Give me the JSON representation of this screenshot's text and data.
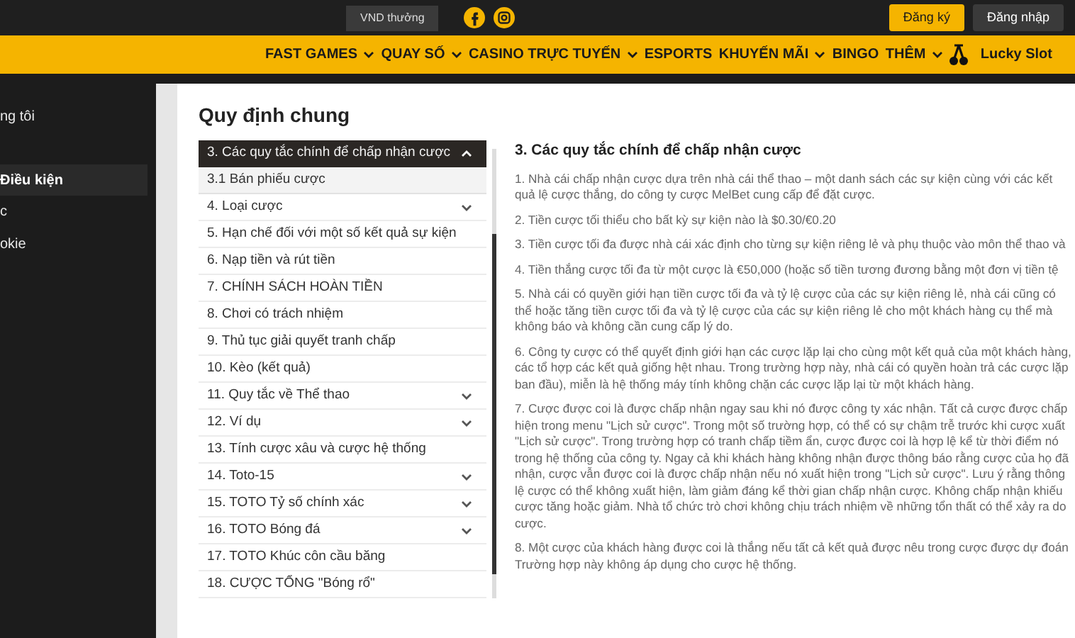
{
  "top_bar": {
    "bonus_text": "VND thưởng",
    "register": "Đăng ký",
    "login": "Đăng nhập"
  },
  "nav": [
    {
      "label": "FAST GAMES",
      "dropdown": true
    },
    {
      "label": "QUAY SỐ",
      "dropdown": true
    },
    {
      "label": "CASINO TRỰC TUYẾN",
      "dropdown": true
    },
    {
      "label": "ESPORTS",
      "dropdown": false
    },
    {
      "label": "KHUYẾN MÃI",
      "dropdown": true
    },
    {
      "label": "BINGO",
      "dropdown": false
    },
    {
      "label": "THÊM",
      "dropdown": true
    },
    {
      "label": "Lucky Slot",
      "kind": "slot"
    }
  ],
  "sidebar": {
    "items": [
      {
        "label": "ng tôi",
        "selected": false
      },
      {
        "label": "Điều kiện",
        "selected": true
      },
      {
        "label": "c",
        "selected": false
      },
      {
        "label": "okie",
        "selected": false
      }
    ]
  },
  "page_title": "Quy định chung",
  "accordion": [
    {
      "label": "3. Các quy tắc chính để chấp nhận cược",
      "kind": "header",
      "expanded": true
    },
    {
      "label": "3.1 Bán phiếu cược",
      "kind": "sub"
    },
    {
      "label": "4. Loại cược",
      "kind": "item",
      "expandable": true
    },
    {
      "label": "5. Hạn chế đối với một số kết quả sự kiện",
      "kind": "item",
      "expandable": false
    },
    {
      "label": "6. Nạp tiền và rút tiền",
      "kind": "item",
      "expandable": false
    },
    {
      "label": "7. CHÍNH SÁCH HOÀN TIỀN",
      "kind": "item",
      "expandable": false
    },
    {
      "label": "8. Chơi có trách nhiệm",
      "kind": "item",
      "expandable": false
    },
    {
      "label": "9. Thủ tục giải quyết tranh chấp",
      "kind": "item",
      "expandable": false
    },
    {
      "label": "10. Kèo (kết quả)",
      "kind": "item",
      "expandable": false
    },
    {
      "label": "11. Quy tắc về Thể thao",
      "kind": "item",
      "expandable": true
    },
    {
      "label": "12. Ví dụ",
      "kind": "item",
      "expandable": true
    },
    {
      "label": "13. Tính cược xâu và cược hệ thống",
      "kind": "item",
      "expandable": false
    },
    {
      "label": "14. Toto-15",
      "kind": "item",
      "expandable": true
    },
    {
      "label": "15. TOTO Tỷ số chính xác",
      "kind": "item",
      "expandable": true
    },
    {
      "label": "16. TOTO Bóng đá",
      "kind": "item",
      "expandable": true
    },
    {
      "label": "17. TOTO Khúc côn cầu băng",
      "kind": "item",
      "expandable": false
    },
    {
      "label": "18. CƯỢC TỔNG \"Bóng rổ\"",
      "kind": "item",
      "expandable": false
    }
  ],
  "article": {
    "heading": "3. Các quy tắc chính để chấp nhận cược",
    "paragraphs": [
      "1. Nhà cái chấp nhận cược dựa trên nhà cái thể thao – một danh sách các sự kiện cùng với các kết quả lệ cược thắng, do công ty cược MelBet cung cấp để đặt cược.",
      "2. Tiền cược tối thiểu cho bất kỳ sự kiện nào là $0.30/€0.20",
      "3. Tiền cược tối đa được nhà cái xác định cho từng sự kiện riêng lẻ và phụ thuộc vào môn thể thao và",
      "4. Tiền thắng cược tối đa từ một cược là €50,000 (hoặc số tiền tương đương bằng một đơn vị tiền tệ",
      "5. Nhà cái có quyền giới hạn tiền cược tối đa và tỷ lệ cược của các sự kiện riêng lẻ, nhà cái cũng có thể hoặc tăng tiền cược tối đa và tỷ lệ cược của các sự kiện riêng lẻ cho một khách hàng cụ thể mà không báo và không cần cung cấp lý do.",
      "6. Công ty cược có thể quyết định giới hạn các cược lặp lại cho cùng một kết quả của một khách hàng, các tổ hợp các kết quả giống hệt nhau. Trong trường hợp này, nhà cái có quyền hoàn trả các cược lặp ban đầu), miễn là hệ thống máy tính không chặn các cược lặp lại từ một khách hàng.",
      "7. Cược được coi là được chấp nhận ngay sau khi nó được công ty xác nhận. Tất cả cược được chấp hiện trong menu \"Lịch sử cược\". Trong một số trường hợp, có thể có sự chậm trễ trước khi cược xuất \"Lịch sử cược\". Trong trường hợp có tranh chấp tiềm ẩn, cược được coi là hợp lệ kể từ thời điểm nó trong hệ thống của công ty. Ngay cả khi khách hàng không nhận được thông báo rằng cược của họ đã nhận, cược vẫn được coi là được chấp nhận nếu nó xuất hiện trong \"Lịch sử cược\". Lưu ý rằng thông lệ cược có thể không xuất hiện, làm giảm đáng kể thời gian chấp nhận cược. Không chấp nhận khiếu cược tăng hoặc giảm. Nhà tổ chức trò chơi không chịu trách nhiệm về những tổn thất có thể xảy ra do cược.",
      "8. Một cược của khách hàng được coi là thắng nếu tất cả kết quả được nêu trong cược được dự đoán Trường hợp này không áp dụng cho cược hệ thống."
    ]
  }
}
